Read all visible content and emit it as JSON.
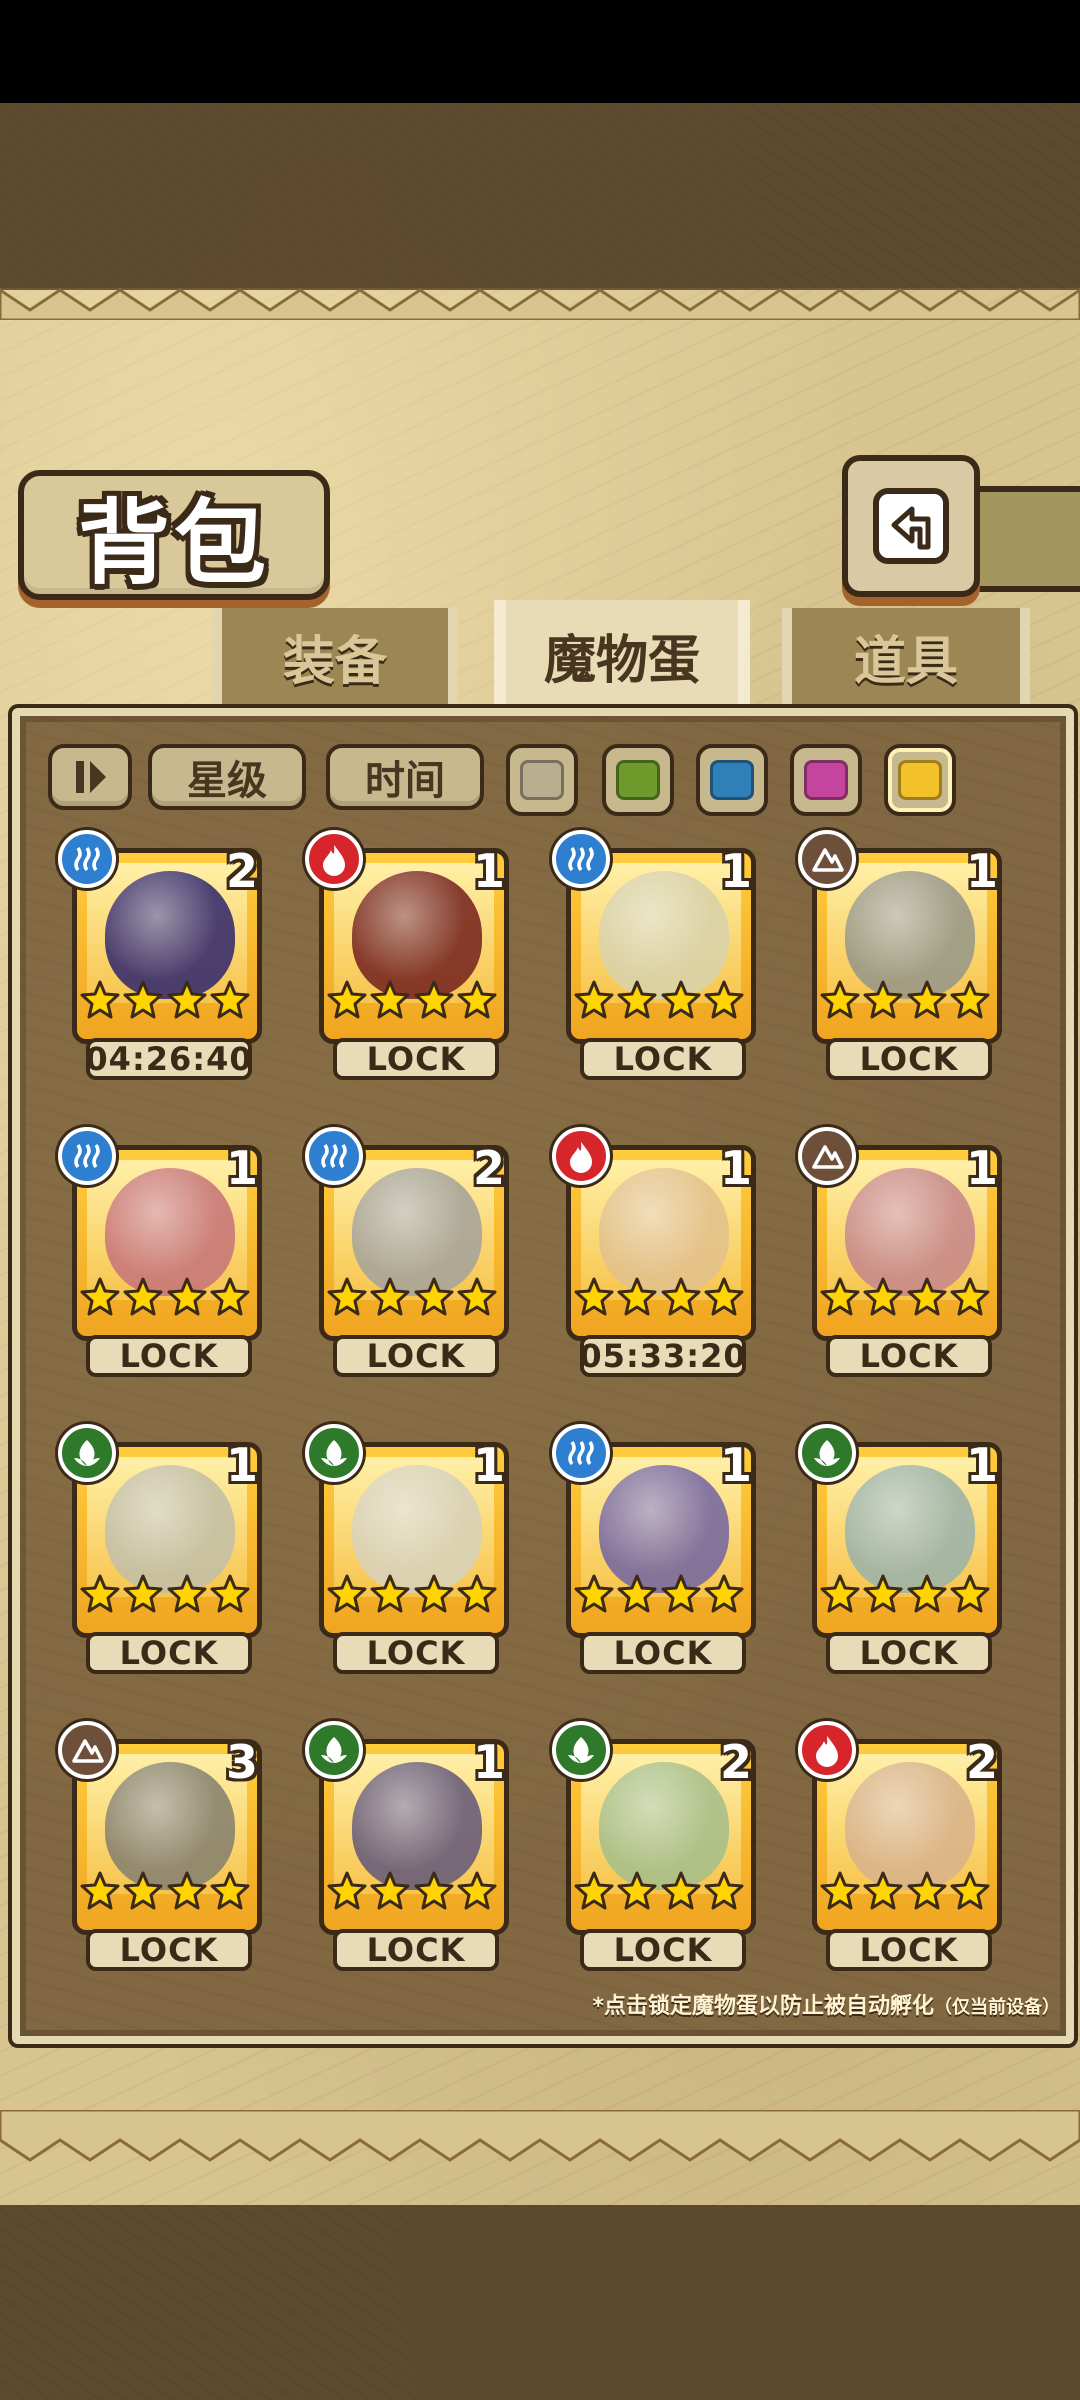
{
  "header": {
    "title": "背包"
  },
  "tabs": [
    {
      "label": "装备",
      "active": false
    },
    {
      "label": "魔物蛋",
      "active": true
    },
    {
      "label": "道具",
      "active": false
    }
  ],
  "filters": {
    "sort_label": "II",
    "star_label": "星级",
    "time_label": "时间",
    "colors": [
      "#b8ad8f",
      "#6e9a2c",
      "#2f7fb8",
      "#c4459e",
      "#f3c12a"
    ]
  },
  "colors": {
    "water": "#2f7fd0",
    "fire": "#d7262b",
    "earth": "#6e4f3a",
    "grass": "#2f7a2a"
  },
  "eggs": [
    {
      "element": "water",
      "count": "2",
      "status": "04:26:40",
      "art": "#3a2f6e"
    },
    {
      "element": "fire",
      "count": "1",
      "status": "LOCK",
      "art": "#7a2a22"
    },
    {
      "element": "water",
      "count": "1",
      "status": "LOCK",
      "art": "#d9d2a8"
    },
    {
      "element": "earth",
      "count": "1",
      "status": "LOCK",
      "art": "#9a9a88"
    },
    {
      "element": "water",
      "count": "1",
      "status": "LOCK",
      "art": "#c9787a"
    },
    {
      "element": "water",
      "count": "2",
      "status": "LOCK",
      "art": "#a8a59a"
    },
    {
      "element": "fire",
      "count": "1",
      "status": "05:33:20",
      "art": "#e3c28c"
    },
    {
      "element": "earth",
      "count": "1",
      "status": "LOCK",
      "art": "#c98a8a"
    },
    {
      "element": "grass",
      "count": "1",
      "status": "LOCK",
      "art": "#c4c0a6"
    },
    {
      "element": "grass",
      "count": "1",
      "status": "LOCK",
      "art": "#d8d2b8"
    },
    {
      "element": "water",
      "count": "1",
      "status": "LOCK",
      "art": "#7a6aa0"
    },
    {
      "element": "grass",
      "count": "1",
      "status": "LOCK",
      "art": "#9fb4a8"
    },
    {
      "element": "earth",
      "count": "3",
      "status": "LOCK",
      "art": "#8a8470"
    },
    {
      "element": "grass",
      "count": "1",
      "status": "LOCK",
      "art": "#6a5e7a"
    },
    {
      "element": "grass",
      "count": "2",
      "status": "LOCK",
      "art": "#a9c08a"
    },
    {
      "element": "fire",
      "count": "2",
      "status": "LOCK",
      "art": "#d9b48a"
    }
  ],
  "footer": {
    "hint_main": "*点击锁定魔物蛋以防止被自动孵化",
    "hint_sub": "（仅当前设备）"
  }
}
